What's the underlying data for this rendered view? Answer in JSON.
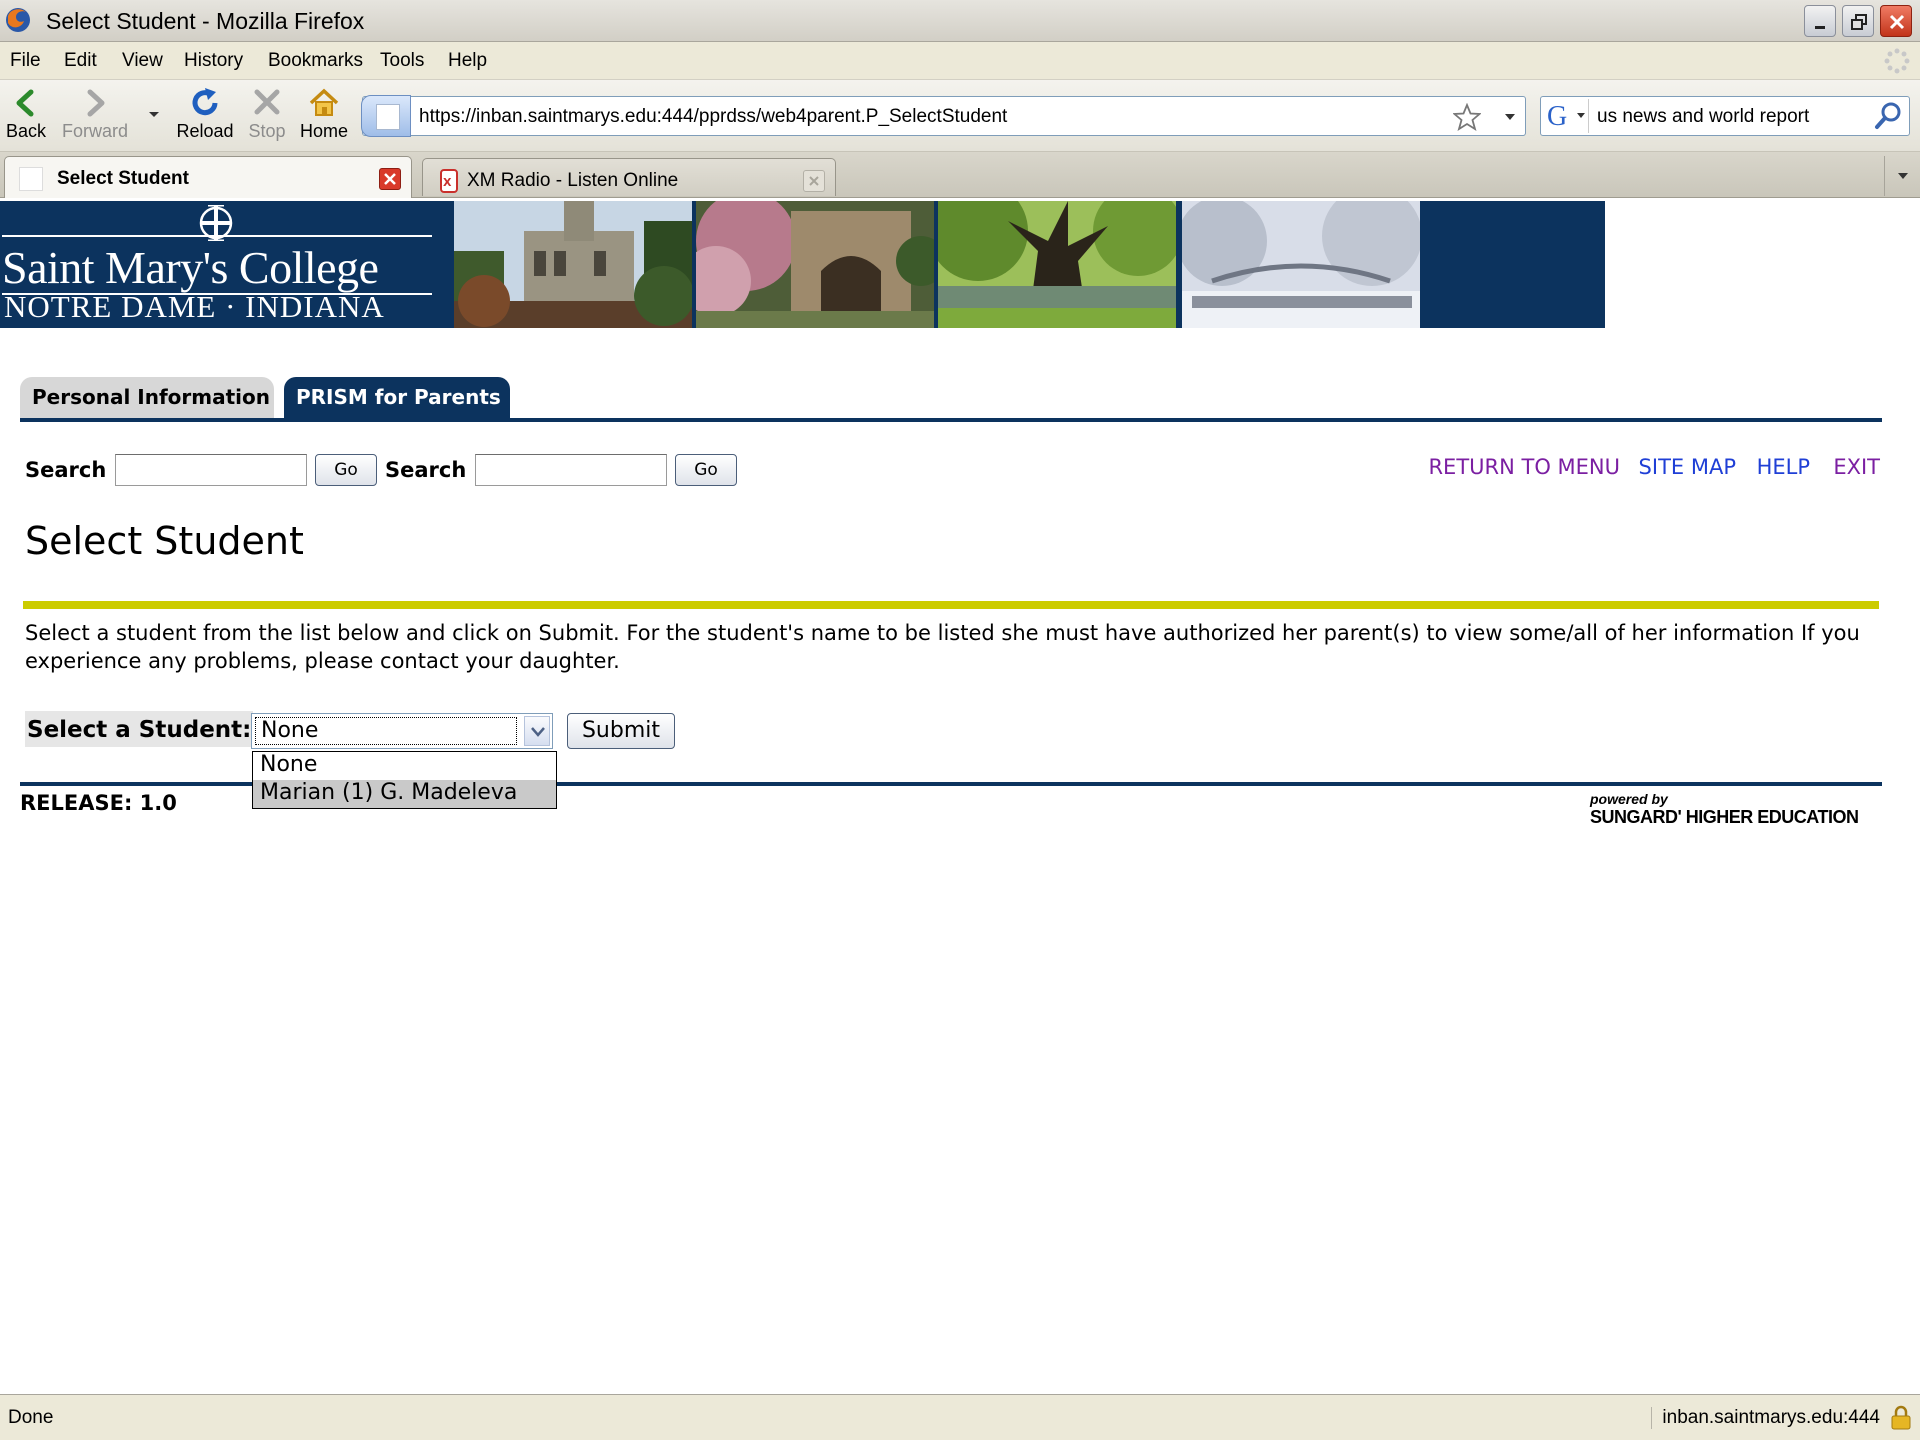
{
  "window": {
    "title": "Select Student - Mozilla Firefox"
  },
  "menubar": {
    "items": [
      "File",
      "Edit",
      "View",
      "History",
      "Bookmarks",
      "Tools",
      "Help"
    ]
  },
  "navbar": {
    "back": "Back",
    "forward": "Forward",
    "reload": "Reload",
    "stop": "Stop",
    "home": "Home",
    "url": "https://inban.saintmarys.edu:444/pprdss/web4parent.P_SelectStudent",
    "search_value": "us news and world report"
  },
  "tabs": [
    {
      "label": "Select Student",
      "active": true
    },
    {
      "label": "XM Radio - Listen Online",
      "active": false
    }
  ],
  "banner": {
    "college_name": "Saint Mary's College",
    "college_place": "NOTRE DAME · INDIANA",
    "brand_color": "#0c335e"
  },
  "page_tabs": {
    "personal": "Personal Information",
    "prism": "PRISM for Parents"
  },
  "search_row": {
    "label1": "Search",
    "go1": "Go",
    "label2": "Search",
    "go2": "Go"
  },
  "top_links": {
    "return_menu": "RETURN TO MENU",
    "site_map": "SITE MAP",
    "help": "HELP",
    "exit": "EXIT"
  },
  "page": {
    "heading": "Select Student",
    "instructions": "Select a student from the list below and click on Submit. For the student's name to be listed she must have authorized her parent(s) to view some/all of her information If you experience any problems, please contact your daughter.",
    "select_label": "Select a Student:",
    "select_value": "None",
    "submit": "Submit",
    "options": [
      "None",
      "Marian (1) G. Madeleva"
    ],
    "release": "RELEASE: 1.0",
    "powered_by": "powered by",
    "sungard": "SUNGARD' HIGHER EDUCATION"
  },
  "statusbar": {
    "status": "Done",
    "host": "inban.saintmarys.edu:444"
  }
}
